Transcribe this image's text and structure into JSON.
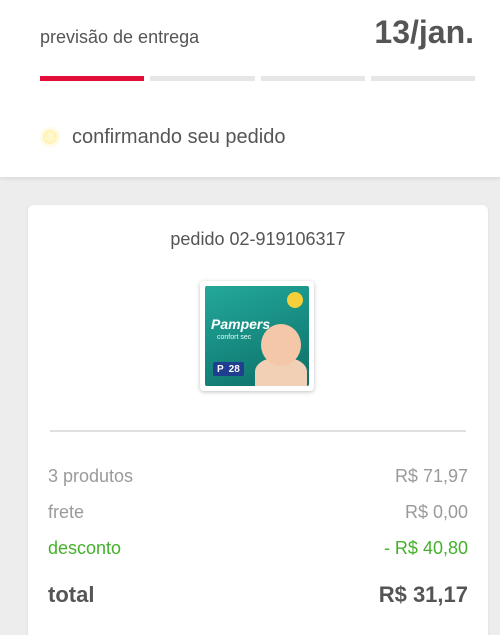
{
  "delivery": {
    "label": "previsão de entrega",
    "date": "13/jan.",
    "progress_steps": 4,
    "progress_active": 1
  },
  "status": {
    "text": "confirmando seu pedido",
    "icon": "pending-dot-icon"
  },
  "order": {
    "id_text": "pedido 02-919106317",
    "product": {
      "brand": "Pampers",
      "line": "confort sec",
      "size": "P",
      "count": "28"
    },
    "summary": {
      "products_label": "3 produtos",
      "products_value": "R$ 71,97",
      "shipping_label": "frete",
      "shipping_value": "R$ 0,00",
      "discount_label": "desconto",
      "discount_value": "- R$ 40,80",
      "total_label": "total",
      "total_value": "R$ 31,17"
    }
  },
  "colors": {
    "accent_red": "#e30d3a",
    "discount_green": "#44b02c",
    "text_dark": "#555555",
    "text_muted": "#9a9a9a",
    "background": "#ededed"
  }
}
